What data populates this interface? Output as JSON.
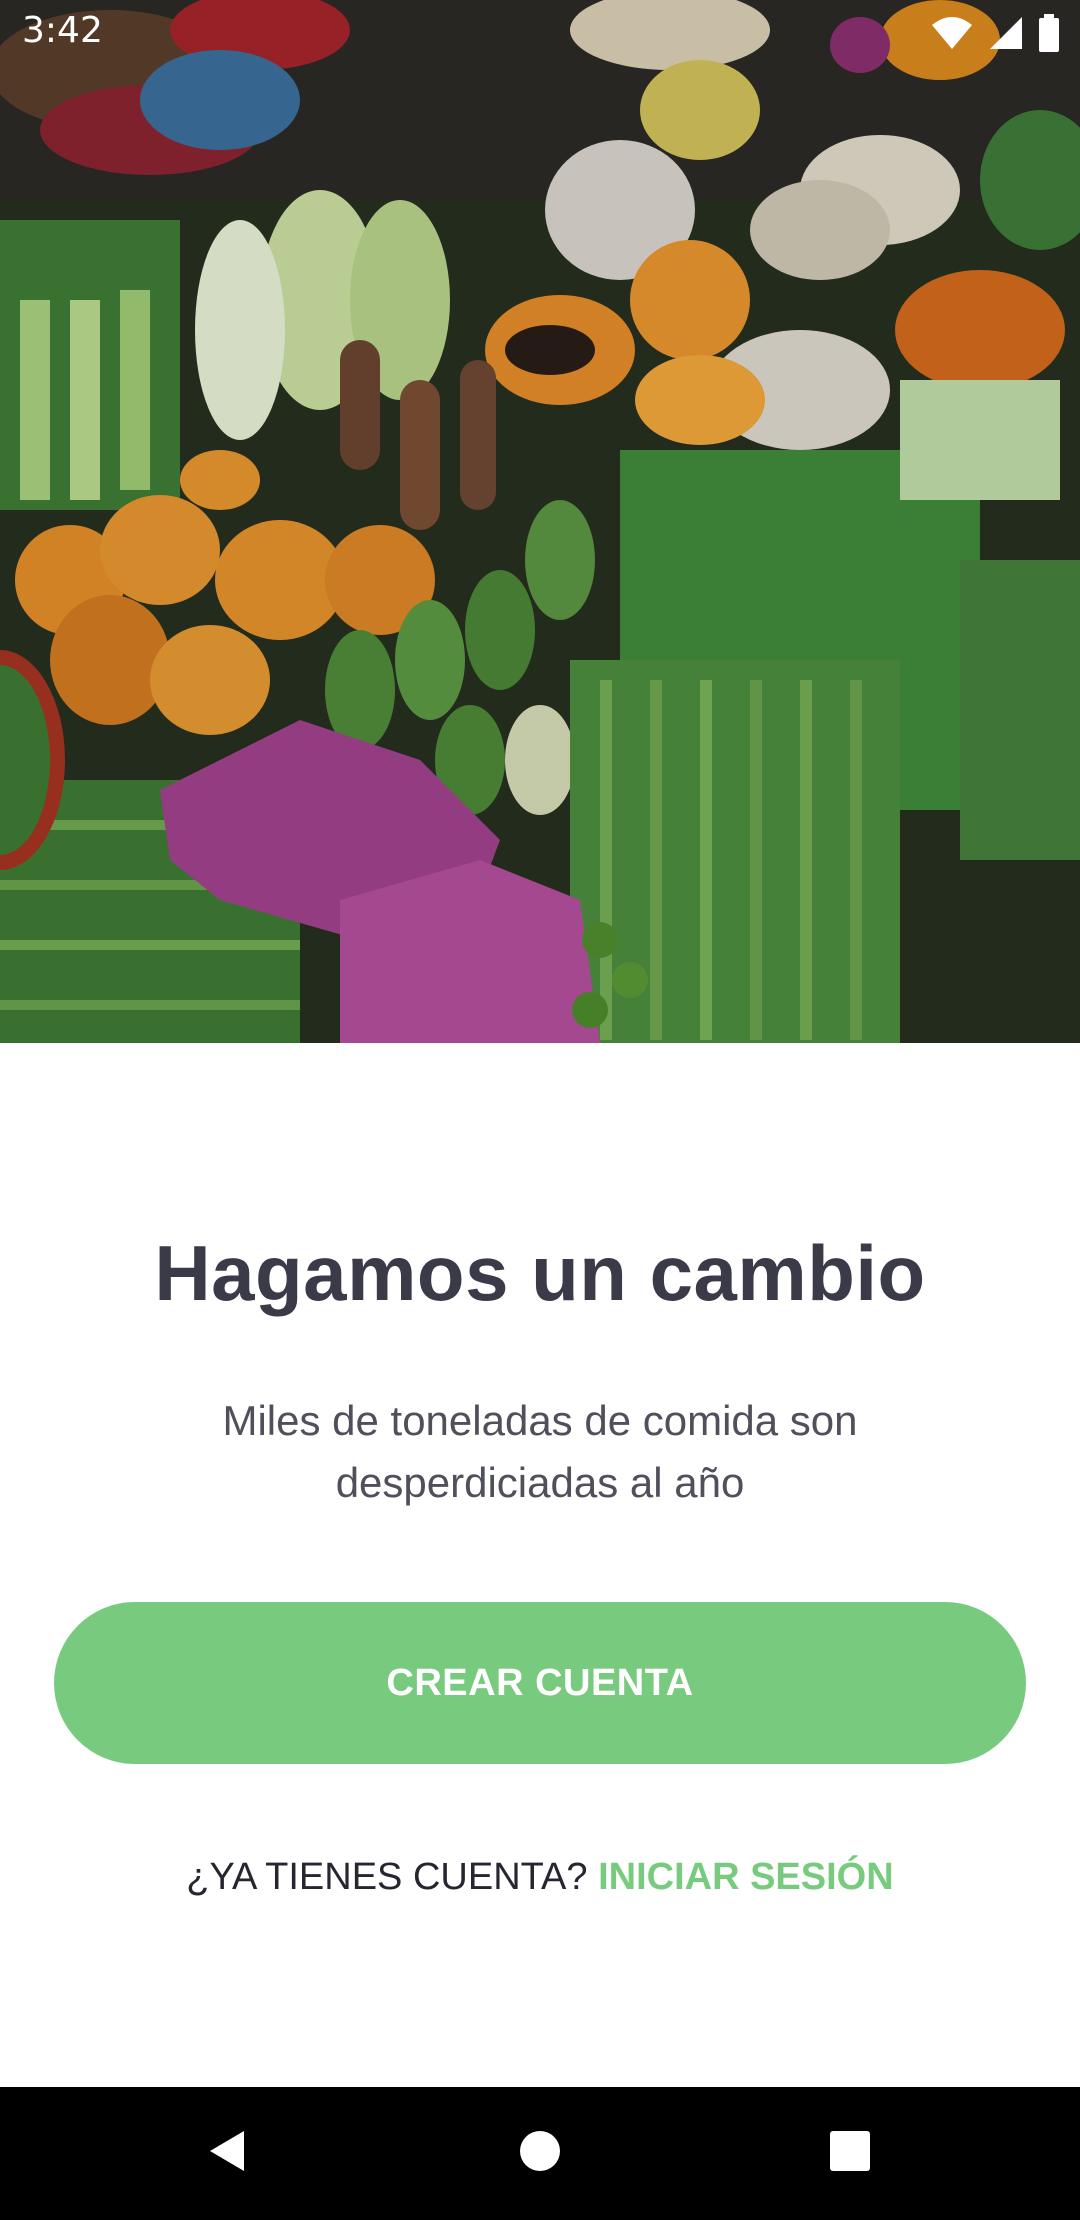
{
  "status_bar": {
    "time": "3:42",
    "icons": [
      "wifi-icon",
      "cell-signal-icon",
      "battery-icon"
    ]
  },
  "hero": {
    "subject": "fresh-vegetables-market-photo"
  },
  "content": {
    "title": "Hagamos un cambio",
    "subtitle": "Miles de toneladas de comida son desperdiciadas al año",
    "create_account_label": "CREAR CUENTA",
    "have_account_text": "¿YA TIENES CUENTA?",
    "login_label": "INICIAR SESIÓN"
  },
  "nav_bar": {
    "buttons": [
      "back-icon",
      "home-icon",
      "recents-icon"
    ]
  },
  "colors": {
    "accent_green": "#78cb7e",
    "title_text": "#3a3a48",
    "body_text": "#50505c",
    "nav_bar": "#000000"
  }
}
